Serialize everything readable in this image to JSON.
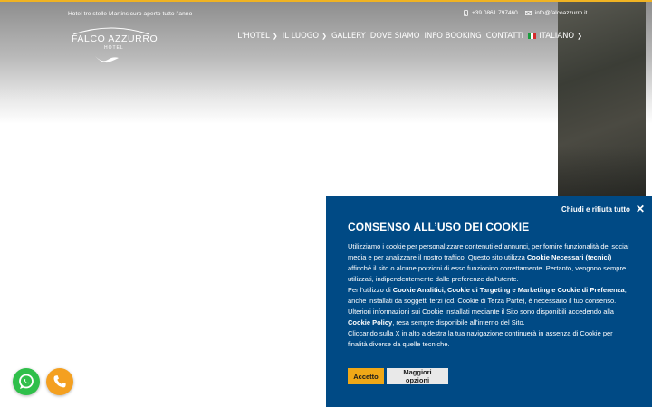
{
  "colors": {
    "accent": "#f0b323",
    "cookie_bg": "#004a85",
    "accept_button": "#f0a817",
    "whatsapp": "#2fbf4a",
    "call": "#f4a020"
  },
  "header": {
    "tagline": "Hotel tre stelle Martinsicuro aperto tutto l'anno",
    "phone": "+39 0861 797460",
    "email": "info@falcoazzurro.it",
    "phone_icon": "mobile-phone-icon",
    "email_icon": "envelope-icon"
  },
  "logo": {
    "name": "FALCO AZZURRO",
    "sub": "HOTEL"
  },
  "nav": {
    "items": [
      {
        "label": "L'HOTEL",
        "dropdown": true
      },
      {
        "label": "IL LUOGO",
        "dropdown": true
      },
      {
        "label": "GALLERY",
        "dropdown": false
      },
      {
        "label": "DOVE SIAMO",
        "dropdown": false
      },
      {
        "label": "INFO BOOKING",
        "dropdown": false
      },
      {
        "label": "CONTATTI",
        "dropdown": false
      }
    ],
    "language": "ITALIANO"
  },
  "cookie": {
    "close_label": "Chiudi e rifiuta tutto",
    "title": "CONSENSO ALL’USO DEI COOKIE",
    "p1_a": "Utilizziamo i cookie per personalizzare contenuti ed annunci, per fornire funzionalità dei social media e per analizzare il nostro traffico. Questo sito utilizza ",
    "p1_b": "Cookie Necessari (tecnici)",
    "p1_c": " affinché il sito o alcune porzioni di esso funzionino correttamente. Pertanto, vengono sempre utilizzati, indipendentemente dalle preferenze dall'utente.",
    "p2_a": "Per l'utilizzo di ",
    "p2_b": "Cookie Analitici, Cookie di Targeting e Marketing e Cookie di Preferenza",
    "p2_c": ", anche installati da soggetti terzi (cd. Cookie di Terza Parte), è necessario il tuo consenso.",
    "p3_a": "Ulteriori informazioni sui Cookie installati mediante il Sito sono disponibili accedendo alla ",
    "p3_b": "Cookie Policy",
    "p3_c": ", resa sempre disponibile all'interno del Sito.",
    "p4": "Cliccando sulla X in alto a destra la tua navigazione continuerà in assenza di Cookie per finalità diverse da quelle tecniche.",
    "accept_label": "Accetto",
    "more_label": "Maggiori opzioni"
  },
  "floating": {
    "whatsapp_icon": "whatsapp-icon",
    "call_icon": "phone-icon"
  }
}
